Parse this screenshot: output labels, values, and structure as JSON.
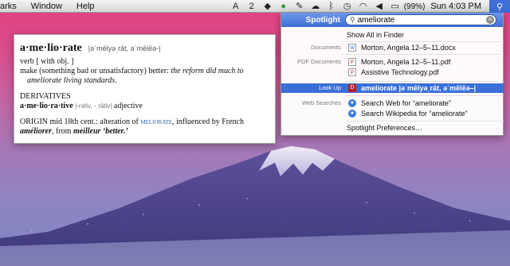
{
  "menubar": {
    "items": [
      "arks",
      "Window",
      "Help"
    ],
    "battery": "(99%)",
    "clock": "Sun 4:03 PM",
    "status_badge": "2",
    "status_icons": [
      "adobe-icon",
      "notification-icon",
      "dropbox-icon",
      "leaf-icon",
      "evernote-icon",
      "cloud-icon",
      "bluetooth-icon",
      "time-machine-icon",
      "wifi-icon",
      "volume-icon",
      "battery-icon",
      "spotlight-icon"
    ]
  },
  "spotlight": {
    "label": "Spotlight",
    "query": "ameliorate",
    "show_all": "Show All in Finder",
    "categories": {
      "documents": "Documents",
      "pdf": "PDF Documents",
      "lookup": "Look Up",
      "web": "Web Searches"
    },
    "results": {
      "doc1": "Morton, Angela 12–5–11.docx",
      "pdf1": "Morton, Angela 12–5–11.pdf",
      "pdf2": "Assistive Technology.pdf",
      "lookup": "ameliorate |əˈmēlyəˌrāt, əˈmēlēə–|",
      "web1": "Search Web for “ameliorate”",
      "web2": "Search Wikipedia for “ameliorate”",
      "prefs": "Spotlight Preferences…"
    }
  },
  "dictionary": {
    "headword": "a·me·lio·rate",
    "pron": "|əˈmēlyəˌrāt, əˈmēlēə-|",
    "pos": "verb [ with obj. ]",
    "def": "make (something bad or unsatisfactory) better:",
    "example_a": "the reform did much to",
    "example_b": "ameliorate living standards",
    "example_end": ".",
    "deriv_title": "DERIVATIVES",
    "deriv_word": "a·me·lio·ra·tive",
    "deriv_pron": "|-rətiv, -ˌrātiv|",
    "deriv_pos": "adjective",
    "origin_label": "ORIGIN mid 18th cent.: alteration of",
    "origin_xref": "meliorate",
    "origin_tail": ", influenced by French",
    "origin_french": "améliorer",
    "origin_from": ", from",
    "origin_meilleur": "meilleur ‘better.’"
  }
}
